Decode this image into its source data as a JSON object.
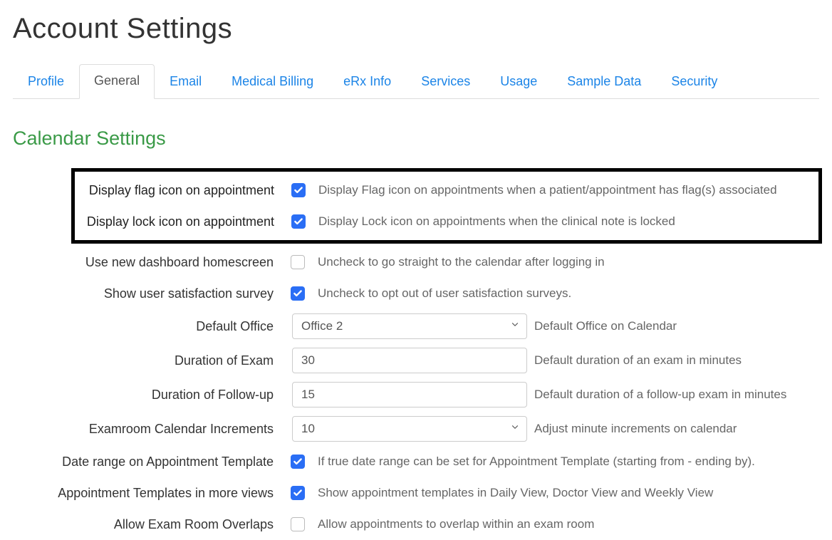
{
  "page_title": "Account Settings",
  "tabs": {
    "items": [
      {
        "label": "Profile",
        "active": false
      },
      {
        "label": "General",
        "active": true
      },
      {
        "label": "Email",
        "active": false
      },
      {
        "label": "Medical Billing",
        "active": false
      },
      {
        "label": "eRx Info",
        "active": false
      },
      {
        "label": "Services",
        "active": false
      },
      {
        "label": "Usage",
        "active": false
      },
      {
        "label": "Sample Data",
        "active": false
      },
      {
        "label": "Security",
        "active": false
      }
    ]
  },
  "section_heading": "Calendar Settings",
  "rows": {
    "flag_icon": {
      "label": "Display flag icon on appointment",
      "checked": true,
      "help": "Display Flag icon on appointments when a patient/appointment has flag(s) associated"
    },
    "lock_icon": {
      "label": "Display lock icon on appointment",
      "checked": true,
      "help": "Display Lock icon on appointments when the clinical note is locked"
    },
    "dashboard": {
      "label": "Use new dashboard homescreen",
      "checked": false,
      "help": "Uncheck to go straight to the calendar after logging in"
    },
    "survey": {
      "label": "Show user satisfaction survey",
      "checked": true,
      "help": "Uncheck to opt out of user satisfaction surveys."
    },
    "default_office": {
      "label": "Default Office",
      "value": "Office 2",
      "help": "Default Office on Calendar"
    },
    "duration_exam": {
      "label": "Duration of Exam",
      "value": "30",
      "help": "Default duration of an exam in minutes"
    },
    "duration_followup": {
      "label": "Duration of Follow-up",
      "value": "15",
      "help": "Default duration of a follow-up exam in minutes"
    },
    "increments": {
      "label": "Examroom Calendar Increments",
      "value": "10",
      "help": "Adjust minute increments on calendar"
    },
    "date_range": {
      "label": "Date range on Appointment Template",
      "checked": true,
      "help": "If true date range can be set for Appointment Template (starting from - ending by)."
    },
    "more_views": {
      "label": "Appointment Templates in more views",
      "checked": true,
      "help": "Show appointment templates in Daily View, Doctor View and Weekly View"
    },
    "overlaps": {
      "label": "Allow Exam Room Overlaps",
      "checked": false,
      "help": "Allow appointments to overlap within an exam room"
    }
  }
}
